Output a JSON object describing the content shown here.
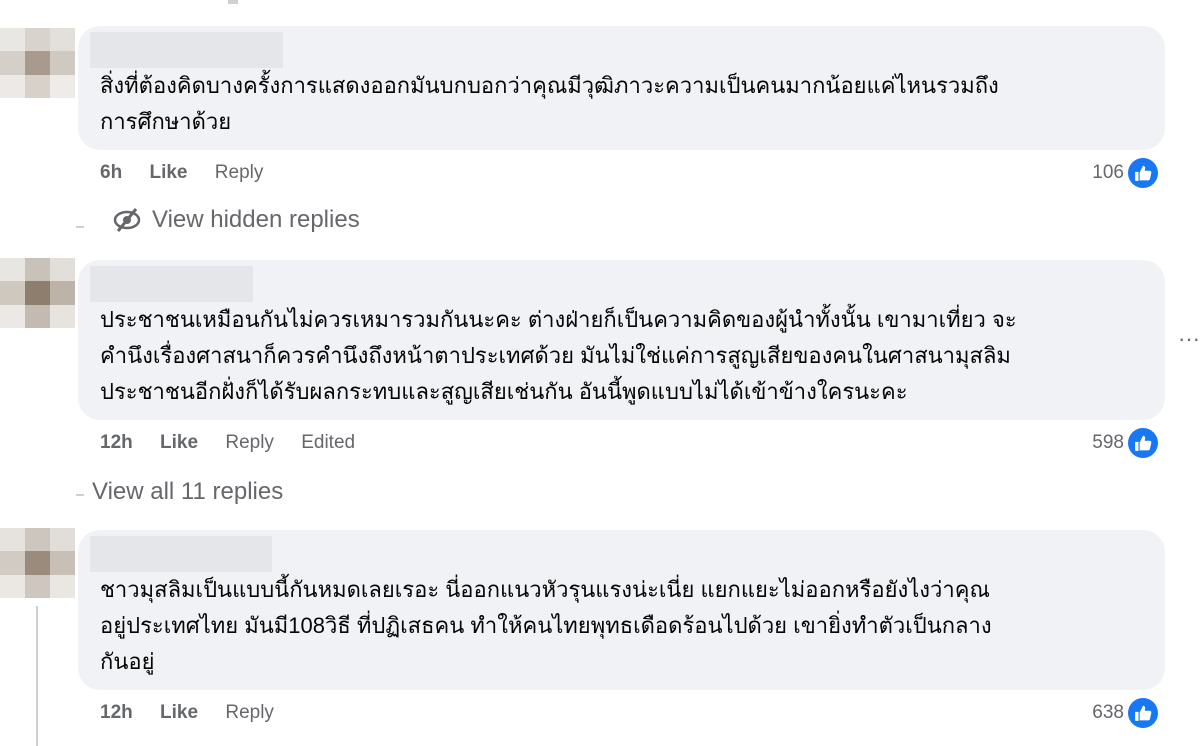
{
  "comments": [
    {
      "text": "สิ่งที่ต้องคิดบางครั้งการแสดงออกมันบกบอกว่าคุณมีวุฒิภาวะความเป็นคนมากน้อยแค่ไหนรวมถึง\nการศึกษาด้วย",
      "time": "6h",
      "like": "Like",
      "reply": "Reply",
      "edited": "",
      "reactions": "106"
    },
    {
      "text": "ประชาชนเหมือนกันไม่ควรเหมารวมกันนะคะ ต่างฝ่ายก็เป็นความคิดของผู้นำทั้งนั้น เขามาเที่ยว จะ\nคำนึงเรื่องศาสนาก็ควรคำนึงถึงหน้าตาประเทศด้วย มันไม่ใช่แค่การสูญเสียของคนในศาสนามุสลิม\nประชาชนอีกฝั่งก็ได้รับผลกระทบและสูญเสียเช่นกัน อันนี้พูดแบบไม่ได้เข้าข้างใครนะคะ",
      "time": "12h",
      "like": "Like",
      "reply": "Reply",
      "edited": "Edited",
      "reactions": "598"
    },
    {
      "text": "ชาวมุสลิมเป็นแบบนี้กันหมดเลยเรอะ นี่ออกแนวหัวรุนแรงน่ะเนี่ย แยกแยะไม่ออกหรือยังไงว่าคุณ\nอยู่ประเทศไทย มันมี108วิธี ที่ปฏิเสธคน ทำให้คนไทยพุทธเดือดร้อนไปด้วย เขายิ่งทำตัวเป็นกลาง\nกันอยู่",
      "time": "12h",
      "like": "Like",
      "reply": "Reply",
      "edited": "",
      "reactions": "638"
    }
  ],
  "view_hidden": "View hidden replies",
  "view_all": "View all 11 replies",
  "more": "···",
  "icons": {
    "hidden": "eye-slash-icon",
    "like": "thumbs-up-icon"
  },
  "colors": {
    "bubble": "#f0f2f5",
    "meta": "#65676b",
    "like_blue": "#1877f2"
  }
}
